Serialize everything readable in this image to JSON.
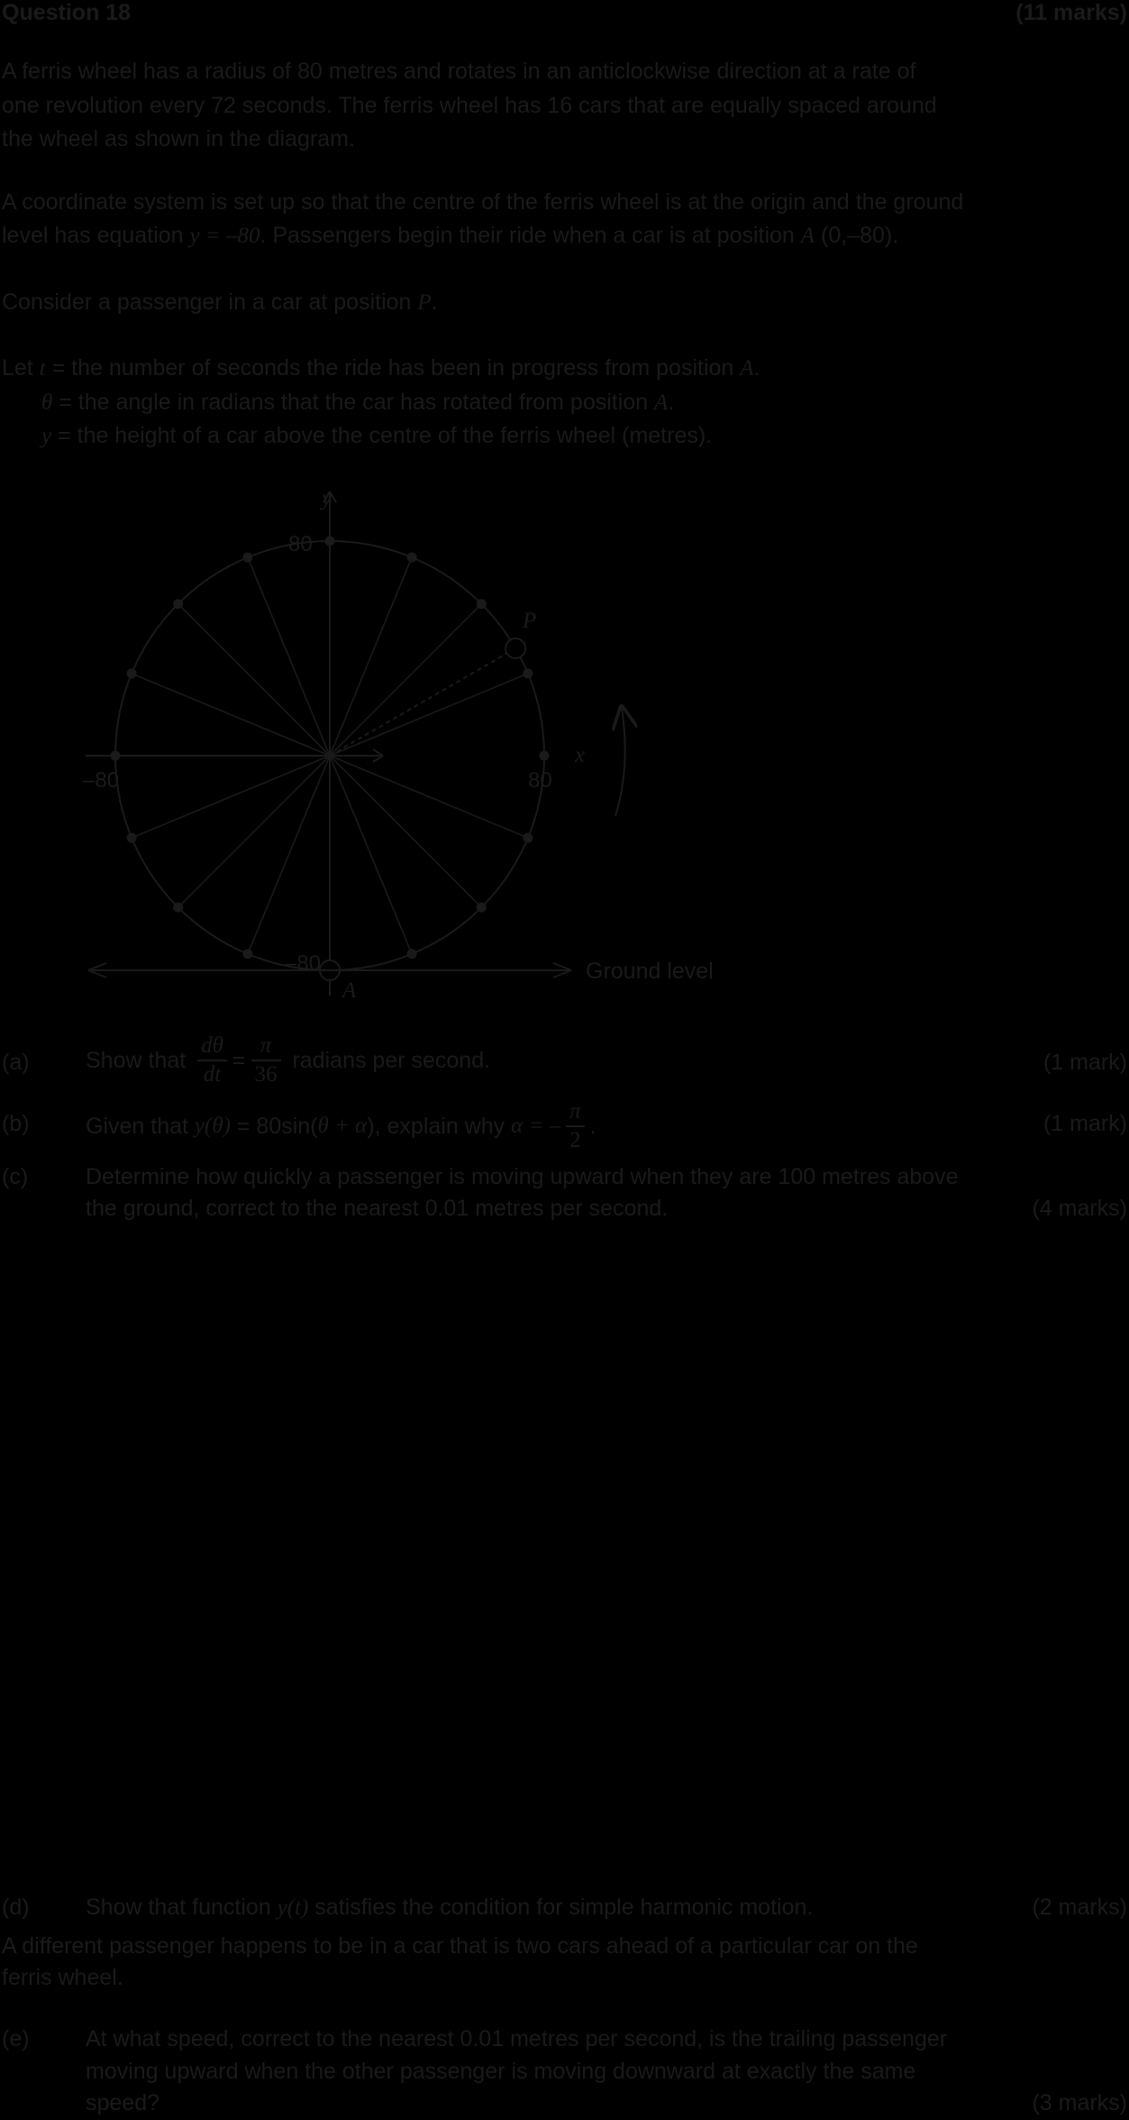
{
  "header": {
    "title": "Question 18",
    "marks": "(11 marks)"
  },
  "intro": {
    "p1_l1": "A ferris wheel has a radius of 80 metres and rotates in an anticlockwise direction at a rate of",
    "p1_l2": "one revolution every 72 seconds. The ferris wheel has 16 cars that are equally spaced around",
    "p1_l3": "the wheel as shown in the diagram.",
    "p2_l1": "A coordinate system is set up so that the centre of the ferris wheel is at the origin and the ground",
    "p2_l2_a": "level has equation ",
    "p2_l2_eq": "y = –80",
    "p2_l2_b": ". Passengers begin their ride when a car is at position ",
    "p2_l2_A": "A",
    "p2_l2_c": " (0,–80).",
    "p3_a": "Consider a passenger in a car at position ",
    "p3_P": "P",
    "p3_b": "."
  },
  "definitions": {
    "let": "Let",
    "t_sym": "t",
    "t_def": " = the number of seconds the ride has been in progress from position ",
    "theta_sym": "θ",
    "theta_def": " = the angle in radians that the car has rotated from position ",
    "A": "A",
    "y_sym": "y",
    "y_def": " = the height of a car above the centre of the ferris wheel (metres)."
  },
  "diagram": {
    "y_axis": "y",
    "x_axis": "x",
    "top": "80",
    "right": "80",
    "left": "–80",
    "bottom": "–80",
    "point_P": "P",
    "point_A": "A",
    "ground": "Ground level",
    "cars": 16,
    "P_angle_deg": 30
  },
  "parts": {
    "a_label": "(a)",
    "a_text_1": "Show that ",
    "a_frac_num": "dθ",
    "a_frac_den": "dt",
    "a_eq": "=",
    "a_frac2_num": "π",
    "a_frac2_den": "36",
    "a_text_2": " radians per second.",
    "a_marks": "(1 mark)",
    "b_label": "(b)",
    "b_text_1": "Given that ",
    "b_func": "y(θ)",
    "b_text_2": " = 80sin(",
    "b_inner": "θ + α",
    "b_text_3": "), explain why ",
    "b_alpha": "α = –",
    "b_frac_num": "π",
    "b_frac_den": "2",
    "b_end": ".",
    "b_marks": "(1 mark)",
    "c_label": "(c)",
    "c_l1": "Determine how quickly a passenger is moving upward when they are 100 metres above",
    "c_l2": "the ground, correct to the nearest 0.01 metres per second.",
    "c_marks": "(4 marks)",
    "d_label": "(d)",
    "d_text_1": "Show that function ",
    "d_func": "y(t)",
    "d_text_2": " satisfies the condition for simple harmonic motion.",
    "d_marks": "(2 marks)",
    "d2_l1": "A different passenger happens to be in a car that is two cars ahead of a particular car on the",
    "d2_l2": "ferris wheel.",
    "e_label": "(e)",
    "e_l1": "At what speed, correct to the nearest 0.01 metres per second, is the trailing passenger",
    "e_l2": "moving upward when the other passenger is moving downward at exactly the same",
    "e_l3": "speed?",
    "e_marks": "(3 marks)"
  }
}
